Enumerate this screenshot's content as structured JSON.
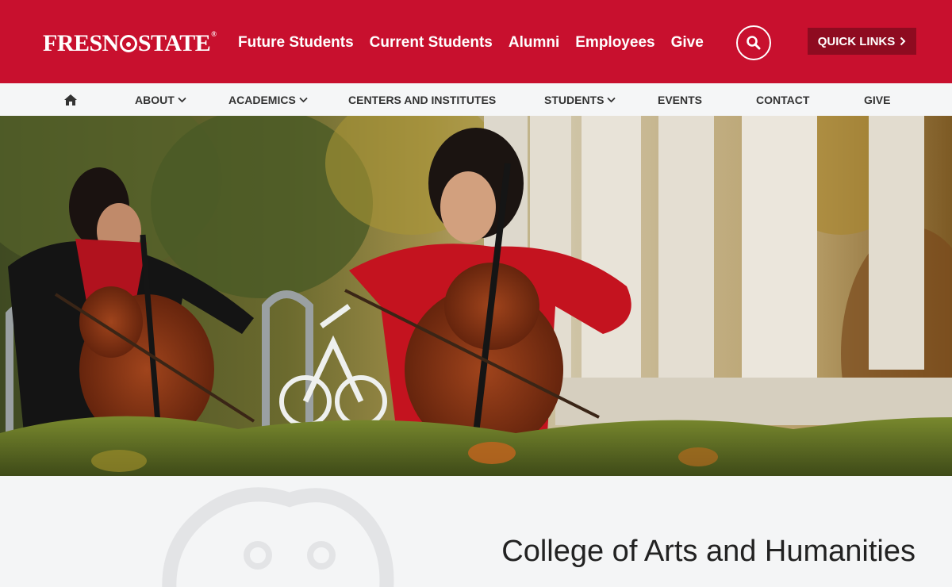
{
  "header": {
    "logo_text": "FRESNO STATE",
    "nav": [
      "Future Students",
      "Current Students",
      "Alumni",
      "Employees",
      "Give"
    ],
    "search_icon": "search-icon",
    "quick_links_label": "QUICK LINKS",
    "quick_links_icon": "chevron-right-icon"
  },
  "subnav": {
    "home_icon": "home-icon",
    "items": [
      {
        "label": "ABOUT",
        "dropdown": true
      },
      {
        "label": "ACADEMICS",
        "dropdown": true
      },
      {
        "label": "CENTERS AND INSTITUTES",
        "dropdown": false
      },
      {
        "label": "STUDENTS",
        "dropdown": true
      },
      {
        "label": "EVENTS",
        "dropdown": false
      },
      {
        "label": "CONTACT",
        "dropdown": false
      },
      {
        "label": "GIVE",
        "dropdown": false
      }
    ]
  },
  "colors": {
    "brand_red": "#c8102e",
    "quick_links_bg": "#8e0b20",
    "nav_bg": "#f5f6f7"
  },
  "main": {
    "college_title": "College of Arts and Humanities"
  }
}
